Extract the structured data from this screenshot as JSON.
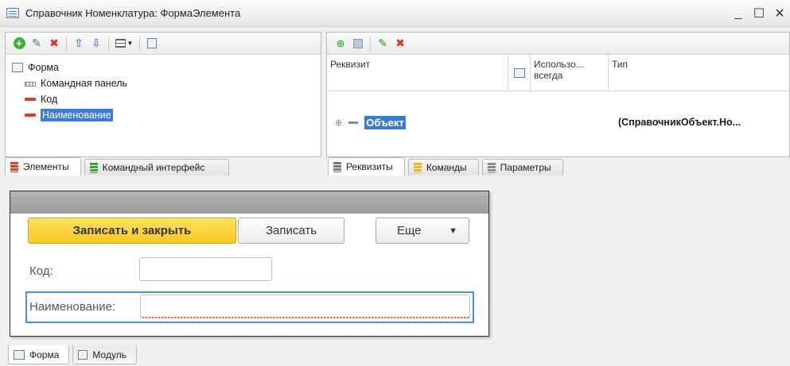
{
  "window": {
    "title": "Справочник Номенклатура: ФормаЭлемента",
    "controls": [
      "_",
      "☐",
      "✕"
    ]
  },
  "elements_tree": {
    "items": [
      {
        "label": "Форма",
        "icon": "form-icon"
      },
      {
        "label": "Командная панель",
        "icon": "command-panel-icon"
      },
      {
        "label": "Код",
        "icon": "field-icon"
      },
      {
        "label": "Наименование",
        "icon": "field-icon",
        "selected": true
      }
    ],
    "tabs": [
      "Элементы",
      "Командный интерфейс"
    ]
  },
  "attributes": {
    "columns": [
      "Реквизит",
      "Использо... всегда",
      "Тип"
    ],
    "rows": [
      {
        "name": "Объект",
        "type": "(СправочникОбъект.Но..."
      }
    ],
    "tabs": [
      "Реквизиты",
      "Команды",
      "Параметры"
    ]
  },
  "preview": {
    "save_close_label": "Записать и закрыть",
    "save_label": "Записать",
    "more_label": "Еще",
    "more_arrow": "▼",
    "code_label": "Код:",
    "name_label": "Наименование:"
  },
  "bottom_tabs": [
    "Форма",
    "Модуль"
  ],
  "colors": {
    "accent_yellow": "#f6c924",
    "selection_blue": "#3d7bd8",
    "delete_red": "#d8362b"
  }
}
